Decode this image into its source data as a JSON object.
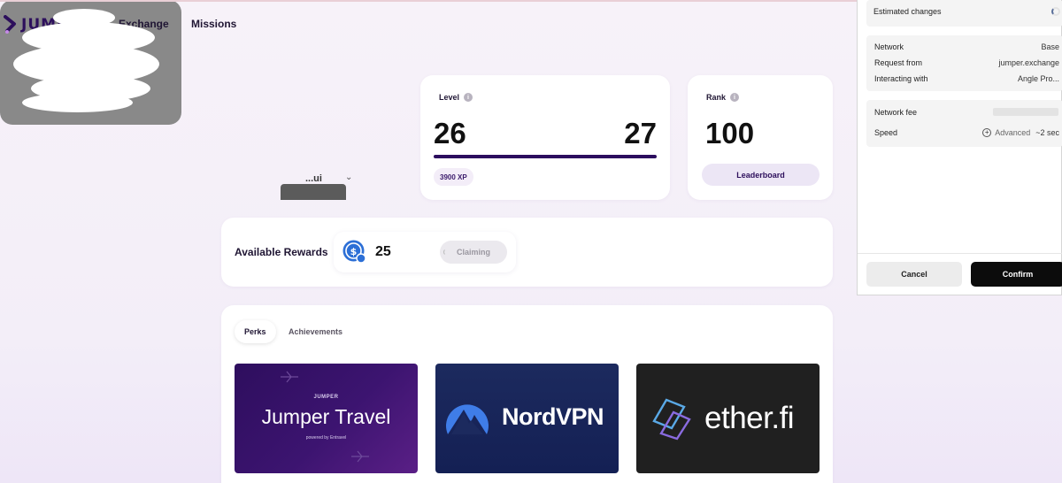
{
  "brand": {
    "name": "JUMPER",
    "color": "#2d0f5c"
  },
  "nav": {
    "exchange": "Exchange",
    "missions": "Missions"
  },
  "profile": {
    "name_fragment": "...ui",
    "chevron": "⌄"
  },
  "level": {
    "label": "Level",
    "current": "26",
    "next": "27",
    "xp": "3900 XP",
    "progress_fraction": 1.0
  },
  "rank": {
    "label": "Rank",
    "value": "100",
    "button": "Leaderboard"
  },
  "rewards": {
    "title": "Available Rewards",
    "amount": "25",
    "claim_label": "Claiming"
  },
  "perks": {
    "tabs": [
      "Perks",
      "Achievements"
    ],
    "cards": [
      {
        "small": "JUMPER",
        "title": "Jumper Travel",
        "sub": "powered by Entravel"
      },
      {
        "title": "NordVPN"
      },
      {
        "title": "ether.fi"
      }
    ]
  },
  "panel": {
    "estimated_changes": "Estimated changes",
    "network_label": "Network",
    "network_value": "Base",
    "request_label": "Request from",
    "request_value": "jumper.exchange",
    "interacting_label": "Interacting with",
    "interacting_value": "Angle Pro...",
    "fee_label": "Network fee",
    "speed_label": "Speed",
    "speed_value": "Advanced",
    "speed_time": "~2 sec",
    "cancel": "Cancel",
    "confirm": "Confirm"
  }
}
